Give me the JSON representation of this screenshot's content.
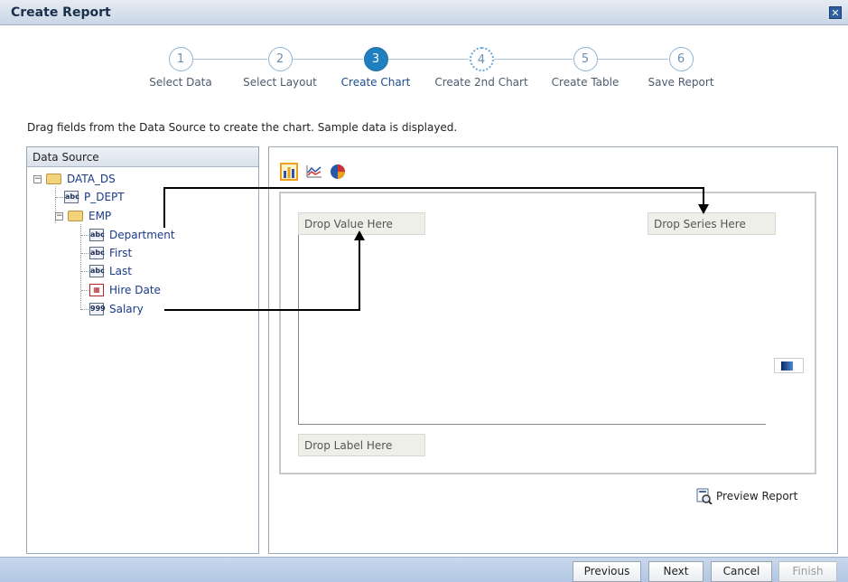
{
  "dialog": {
    "title": "Create Report"
  },
  "steps": [
    {
      "num": "1",
      "label": "Select Data"
    },
    {
      "num": "2",
      "label": "Select Layout"
    },
    {
      "num": "3",
      "label": "Create Chart"
    },
    {
      "num": "4",
      "label": "Create 2nd Chart"
    },
    {
      "num": "5",
      "label": "Create Table"
    },
    {
      "num": "6",
      "label": "Save Report"
    }
  ],
  "instructions": "Drag fields from the Data Source to create the chart. Sample data is displayed.",
  "data_source": {
    "header": "Data Source",
    "root": "DATA_DS",
    "items": [
      {
        "label": "P_DEPT",
        "icon": "abc"
      },
      {
        "label": "EMP"
      },
      {
        "label": "Department",
        "icon": "abc"
      },
      {
        "label": "First",
        "icon": "abc"
      },
      {
        "label": "Last",
        "icon": "abc"
      },
      {
        "label": "Hire Date"
      },
      {
        "label": "Salary",
        "icon": "999"
      }
    ]
  },
  "chart": {
    "drop_value": "Drop Value Here",
    "drop_series": "Drop Series Here",
    "drop_label": "Drop Label Here",
    "preview": "Preview Report"
  },
  "buttons": {
    "previous": "Previous",
    "next": "Next",
    "cancel": "Cancel",
    "finish": "Finish"
  }
}
